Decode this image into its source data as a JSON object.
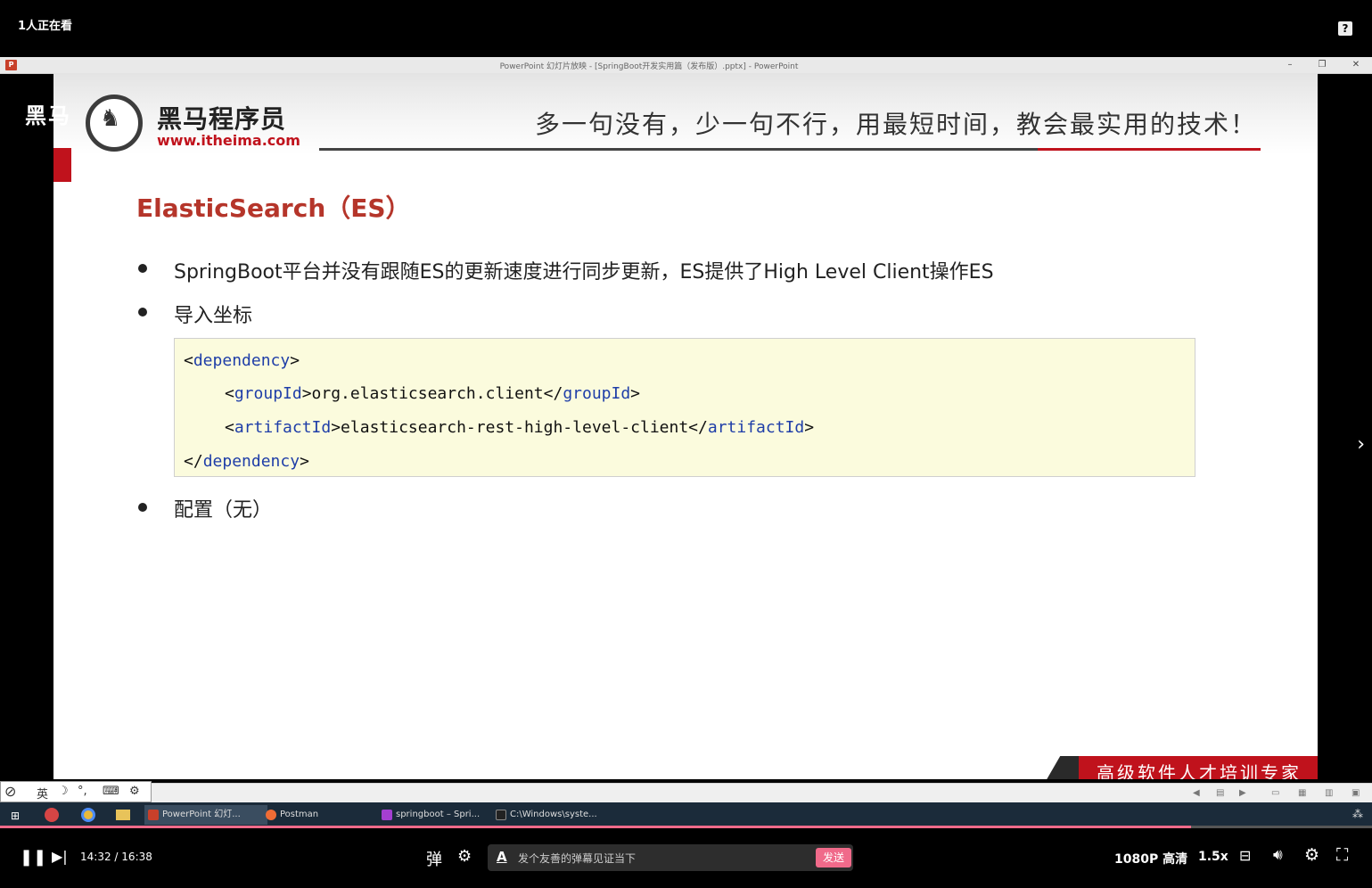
{
  "player": {
    "viewer_count": "1人正在看",
    "help_icon": "?",
    "time_current": "14:32",
    "time_sep": "/",
    "time_total": "16:38",
    "danmaku_placeholder": "发个友善的弹幕见证当下",
    "send_label": "发送",
    "quality": "1080P 高清",
    "speed": "1.5x",
    "progress_fraction": 0.868,
    "accent_color": "#f06a8a"
  },
  "ppt_window": {
    "title": "PowerPoint 幻灯片放映 - [SpringBoot开发实用篇（发布版）.pptx] - PowerPoint",
    "app_icon": "P",
    "minimize": "–",
    "restore": "❐",
    "close": "✕"
  },
  "slide": {
    "watermark": "黑马",
    "brand_cn": "黑马程序员",
    "brand_url": "www.itheima.com",
    "slogan": "多一句没有，少一句不行，用最短时间，教会最实用的技术！",
    "title": "ElasticSearch（ES）",
    "bullets": [
      "SpringBoot平台并没有跟随ES的更新速度进行同步更新，ES提供了High Level Client操作ES",
      "导入坐标",
      "配置（无）"
    ],
    "code": {
      "l1_open": "<",
      "l1_tag": "dependency",
      "l1_close": ">",
      "l2_open": "<",
      "l2_tag": "groupId",
      "l2_mid": ">org.elasticsearch.client</",
      "l2_tag2": "groupId",
      "l2_close": ">",
      "l3_open": "<",
      "l3_tag": "artifactId",
      "l3_mid": ">elasticsearch-rest-high-level-client</",
      "l3_tag2": "artifactId",
      "l3_close": ">",
      "l4_open": "</",
      "l4_tag": "dependency",
      "l4_close": ">"
    },
    "footer": "高级软件人才培训专家",
    "brand_red": "#c0121c"
  },
  "ime": {
    "mode": "英",
    "moon": "☽",
    "punct": "°,",
    "keyboard": "⌨",
    "settings": "⚙"
  },
  "taskbar": {
    "items": [
      "PowerPoint 幻灯...",
      "Postman",
      "springboot – Spri...",
      "C:\\Windows\\syste..."
    ]
  }
}
